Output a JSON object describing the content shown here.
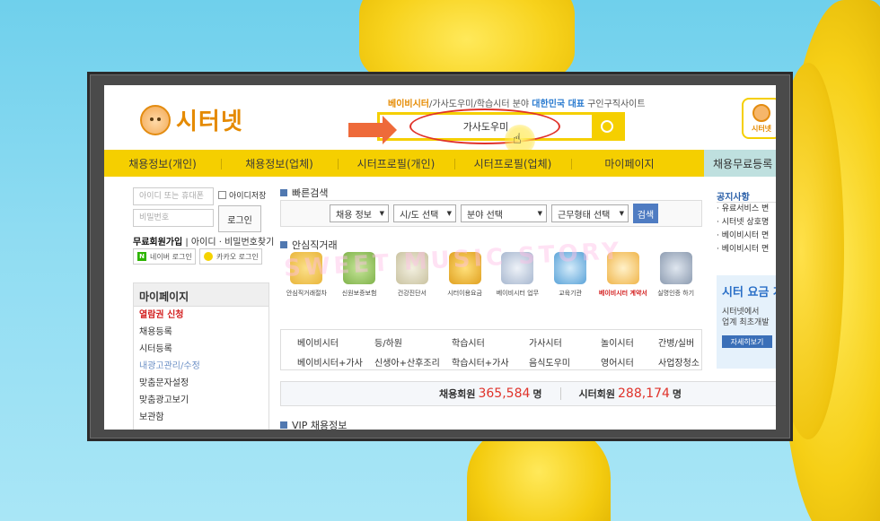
{
  "header": {
    "logo_text": "시터넷",
    "tagline_hl1": "베이비시터",
    "tagline_mid": "/가사도우미/학습시터 분야 ",
    "tagline_hl2": "대한민국 대표",
    "tagline_end": " 구인구직사이트",
    "search_value": "가사도우미",
    "mini_logo_text": "시터넷"
  },
  "nav": {
    "items": [
      "채용정보(개인)",
      "채용정보(업체)",
      "시터프로필(개인)",
      "시터프로필(업체)",
      "마이페이지"
    ],
    "last": "채용무료등록"
  },
  "login": {
    "id_placeholder": "아이디 또는 휴대폰",
    "pw_placeholder": "비밀번호",
    "save_id": "아이디저장",
    "login_btn": "로그인",
    "join": "무료회원가입",
    "find": " | 아이디 · 비밀번호찾기",
    "naver": "네이버 로그인",
    "kakao": "카카오 로그인"
  },
  "mypage": {
    "title": "마이페이지",
    "items": [
      "열람권 신청",
      "채용등록",
      "시터등록",
      "내광고관리/수정",
      "맞춤문자설정",
      "맞춤광고보기",
      "보관함"
    ]
  },
  "quick": {
    "title": "빠른검색",
    "selects": [
      "채용 정보",
      "시/도 선택",
      "분야 선택",
      "근무형태 선택"
    ],
    "go": "검색"
  },
  "safe": {
    "title": "안심직거래",
    "icons": [
      "안심직거래절차",
      "신원보증보험",
      "건강진단서",
      "시터이용요금",
      "베이비시터 업무",
      "교육기관",
      "베이비시터 계약서",
      "실명인증 하기"
    ]
  },
  "links": [
    "베이비시터",
    "등/하원",
    "학습시터",
    "가사시터",
    "놀이시터",
    "간병/실버",
    "베이비시터+가사",
    "신생아+산후조리",
    "학습시터+가사",
    "음식도우미",
    "영어시터",
    "사업장청소"
  ],
  "stats": {
    "recruit_label": "채용회원",
    "recruit_num": "365,584",
    "sitter_label": "시터회원",
    "sitter_num": "288,174",
    "unit": "명"
  },
  "vip": "VIP 채용정보",
  "notice": {
    "title": "공지사항",
    "items": [
      "· 유료서비스 변",
      "· 시터넷 상호명",
      "· 베이비시터 면",
      "· 베이비시터 면"
    ]
  },
  "promo": {
    "title": "시터 요금 계",
    "line1": "시터넷에서",
    "line2": "업계 최초개발",
    "btn": "자세히보기"
  },
  "watermark": "SWEET MUSIC STORY",
  "colors": {
    "brand_yellow": "#f5cf00",
    "brand_orange": "#e58a00",
    "accent_blue": "#4f7cc2",
    "alert_red": "#e0322a"
  }
}
